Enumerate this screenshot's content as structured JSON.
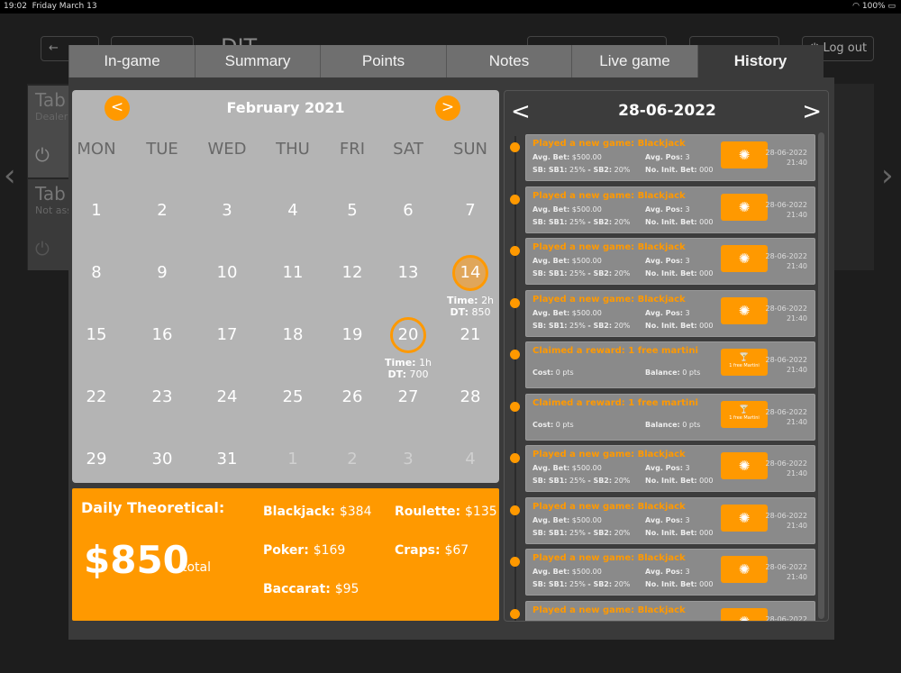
{
  "status": {
    "time": "19:02",
    "date": "Friday March 13",
    "battery": "100%"
  },
  "background": {
    "title": "DIT",
    "logout": "Log out",
    "tables": [
      {
        "name": "Tab",
        "sub": "Dealer"
      },
      {
        "name": "Tab",
        "sub": "Not ass"
      }
    ]
  },
  "tabs": [
    "In-game",
    "Summary",
    "Points",
    "Notes",
    "Live game",
    "History"
  ],
  "active_tab": "History",
  "calendar": {
    "month": "February 2021",
    "prev": "<",
    "next": ">",
    "weekdays": [
      "MON",
      "TUE",
      "WED",
      "THU",
      "FRI",
      "SAT",
      "SUN"
    ],
    "weeks": [
      [
        "1",
        "2",
        "3",
        "4",
        "5",
        "6",
        "7"
      ],
      [
        "8",
        "9",
        "10",
        "11",
        "12",
        "13",
        "14"
      ],
      [
        "15",
        "16",
        "17",
        "18",
        "19",
        "20",
        "21"
      ],
      [
        "22",
        "23",
        "24",
        "25",
        "26",
        "27",
        "28"
      ],
      [
        "29",
        "30",
        "31",
        "1",
        "2",
        "3",
        "4"
      ]
    ],
    "highlights": [
      {
        "day": "14",
        "time_label": "Time:",
        "time": "2h",
        "dt_label": "DT:",
        "dt": "850"
      },
      {
        "day": "20",
        "time_label": "Time:",
        "time": "1h",
        "dt_label": "DT:",
        "dt": "700"
      }
    ]
  },
  "daily": {
    "title": "Daily Theoretical:",
    "total": "$850",
    "total_label": "total",
    "games": [
      {
        "label": "Blackjack:",
        "value": "$384"
      },
      {
        "label": "Roulette:",
        "value": "$135"
      },
      {
        "label": "Poker:",
        "value": "$169"
      },
      {
        "label": "Craps:",
        "value": "$67"
      },
      {
        "label": "Baccarat:",
        "value": "$95"
      }
    ]
  },
  "history": {
    "date": "28-06-2022",
    "prev": "<",
    "next": ">",
    "game": {
      "title": "Played a new game: Blackjack",
      "avg_bet_label": "Avg. Bet:",
      "avg_bet": "$500.00",
      "avg_pos_label": "Avg. Pos:",
      "avg_pos": "3",
      "sb_label": "SB: SB1:",
      "sb1": "25%",
      "sb2_label": "- SB2:",
      "sb2": "20%",
      "init_label": "No. Init. Bet:",
      "init": "000"
    },
    "reward": {
      "title": "Claimed a reward: 1 free martini",
      "cost_label": "Cost:",
      "cost": "0 pts",
      "balance_label": "Balance:",
      "balance": "0 pts",
      "ticket_text": "1 free Martini"
    },
    "time": "21:40",
    "types": [
      "game",
      "game",
      "game",
      "game",
      "reward",
      "reward",
      "game",
      "game",
      "game",
      "game"
    ]
  },
  "colors": {
    "accent": "#ff9900",
    "calendar_bg": "#b4b4b4",
    "panel": "#3a3a3a"
  }
}
